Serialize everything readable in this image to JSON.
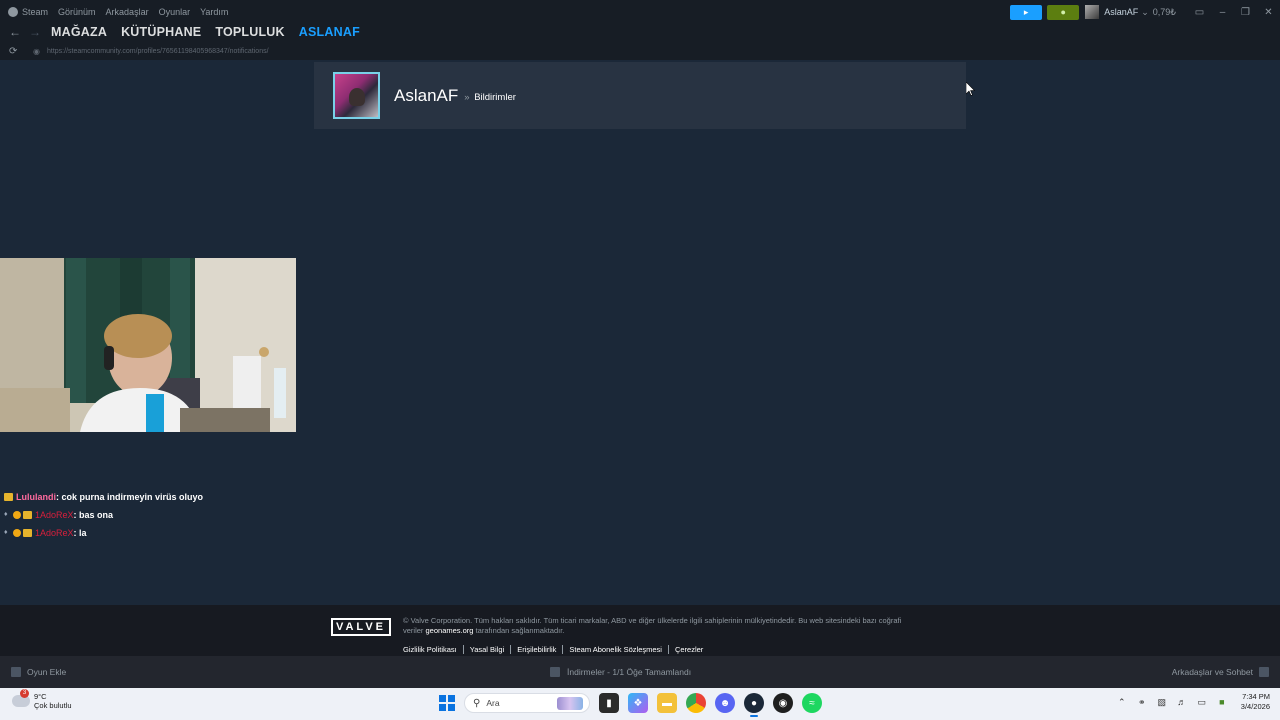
{
  "titlebar": {
    "menu": [
      "Steam",
      "Görünüm",
      "Arkadaşlar",
      "Oyunlar",
      "Yardım"
    ],
    "user_name": "AslanAF",
    "wallet": "0,79₺"
  },
  "nav": {
    "tabs": [
      "MAĞAZA",
      "KÜTÜPHANE",
      "TOPLULUK",
      "ASLANAF"
    ],
    "active_tab": "ASLANAF"
  },
  "url": "https://steamcommunity.com/profiles/76561198405968347/notifications/",
  "profile": {
    "name": "AslanAF",
    "separator": "»",
    "section": "Bildirimler"
  },
  "chat": [
    {
      "user": "Lululandi",
      "message": ": cok purna indirmeyin virüs oluyo"
    },
    {
      "user": "1AdoReX",
      "message": ": bas ona"
    },
    {
      "user": "1AdoReX",
      "message": ": la"
    }
  ],
  "footer": {
    "logo": "VALVE",
    "copyright_line1": "© Valve Corporation. Tüm hakları saklıdır. Tüm ticari markalar, ABD ve diğer ülkelerde ilgili sahiplerinin mülkiyetindedir. Bu web sitesindeki bazı coğrafi",
    "copyright_pre": "veriler",
    "copyright_link": "geonames.org",
    "copyright_post": "tarafından sağlanmaktadır.",
    "links": [
      "Gizlilik Politikası",
      "Yasal Bilgi",
      "Erişilebilirlik",
      "Steam Abonelik Sözleşmesi",
      "Çerezler"
    ]
  },
  "bottombar": {
    "add_game": "Oyun Ekle",
    "downloads": "İndirmeler - 1/1 Öğe Tamamlandı",
    "friends": "Arkadaşlar ve Sohbet"
  },
  "taskbar": {
    "weather_badge": "3",
    "temperature": "9°C",
    "condition": "Çok bulutlu",
    "search_placeholder": "Ara",
    "time": "7:34 PM",
    "date": "3/4/2026"
  },
  "colors": {
    "background": "#1b2838",
    "accent": "#1a9fff",
    "notification_green": "#5c7e10"
  }
}
